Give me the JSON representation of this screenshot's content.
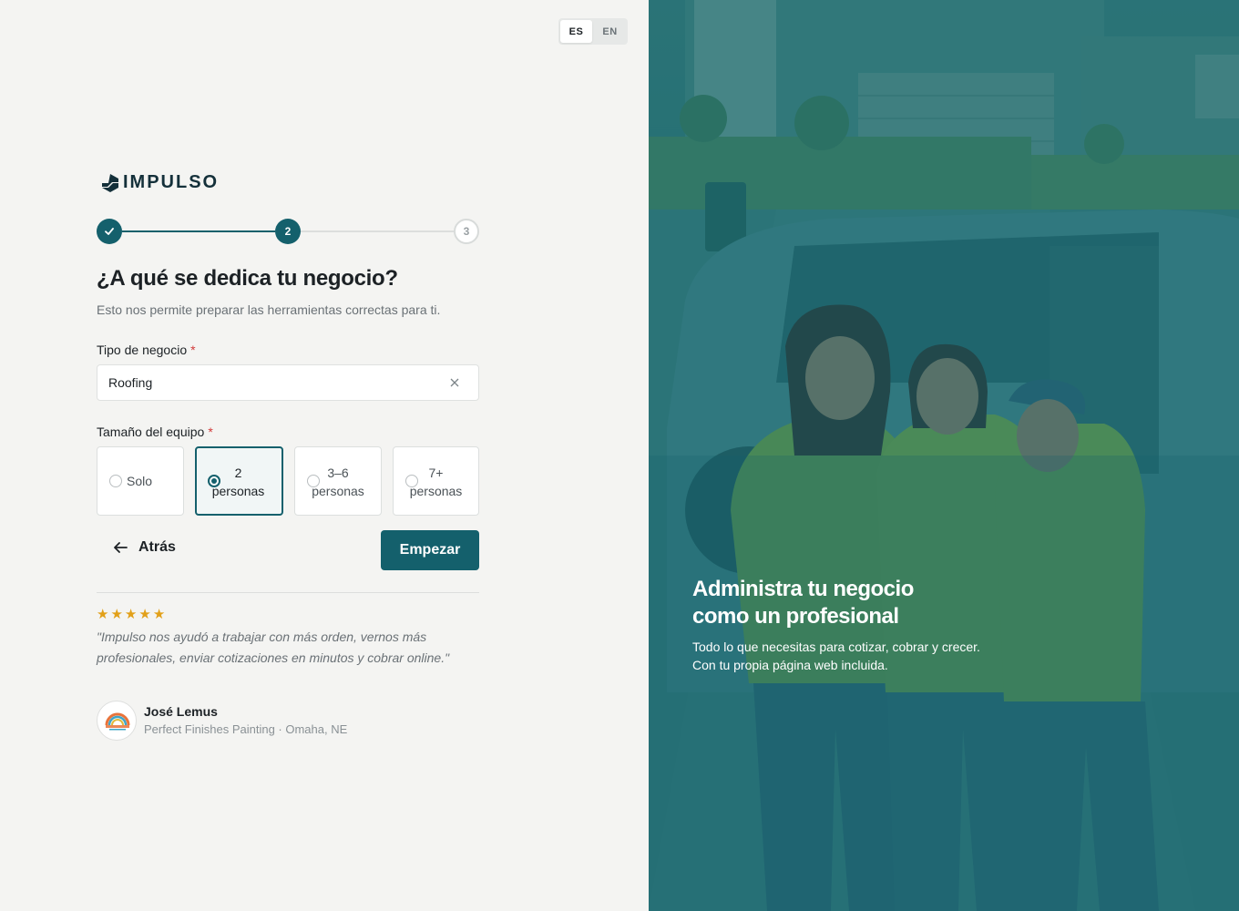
{
  "language": {
    "options": [
      "ES",
      "EN"
    ],
    "selected": "ES"
  },
  "brand": {
    "name": "IMPULSO"
  },
  "stepper": {
    "steps": [
      "",
      "2",
      "3"
    ],
    "current": 2,
    "completed": 1
  },
  "form": {
    "title": "¿A qué se dedica tu negocio?",
    "subtitle": "Esto nos permite preparar las herramientas correctas para ti.",
    "business_type": {
      "label": "Tipo de negocio",
      "required_mark": "*",
      "value": "Roofing"
    },
    "team_size": {
      "label": "Tamaño del equipo",
      "required_mark": "*",
      "options": [
        {
          "line1": "Solo",
          "line2": ""
        },
        {
          "line1": "2",
          "line2": "personas"
        },
        {
          "line1": "3–6",
          "line2": "personas"
        },
        {
          "line1": "7+",
          "line2": "personas"
        }
      ],
      "selected_index": 1
    },
    "back_label": "Atrás",
    "submit_label": "Empezar"
  },
  "testimonial": {
    "rating": 5,
    "quote": "\"Impulso nos ayudó a trabajar con más orden, vernos más profesionales, enviar cotizaciones en minutos y cobrar online.\"",
    "author": "José Lemus",
    "company": "Perfect Finishes Painting · Omaha, NE"
  },
  "hero": {
    "title_line1": "Administra tu negocio",
    "title_line2": "como un profesional",
    "sub_line1": "Todo lo que necesitas para cotizar, cobrar y crecer.",
    "sub_line2": "Con tu propia página web incluida."
  },
  "colors": {
    "primary": "#14606c",
    "star": "#e2a019",
    "required": "#d23a3a",
    "overlay": "#2f7677"
  }
}
